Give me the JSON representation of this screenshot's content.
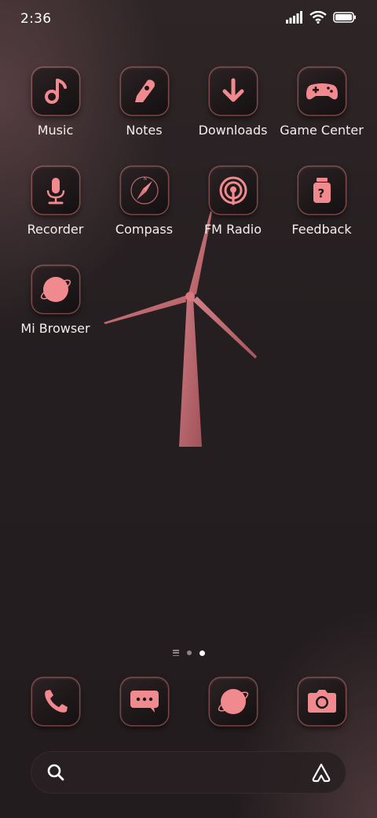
{
  "status_bar": {
    "time": "2:36",
    "icons": [
      "signal-icon",
      "wifi-icon",
      "battery-icon"
    ]
  },
  "apps": [
    {
      "label": "Music",
      "icon": "music-note-icon"
    },
    {
      "label": "Notes",
      "icon": "notes-icon"
    },
    {
      "label": "Downloads",
      "icon": "download-icon"
    },
    {
      "label": "Game Center",
      "icon": "gamepad-icon"
    },
    {
      "label": "Recorder",
      "icon": "microphone-icon"
    },
    {
      "label": "Compass",
      "icon": "compass-icon"
    },
    {
      "label": "FM Radio",
      "icon": "radio-icon"
    },
    {
      "label": "Feedback",
      "icon": "feedback-icon"
    },
    {
      "label": "Mi Browser",
      "icon": "planet-icon"
    }
  ],
  "page_indicator": {
    "pages": 2,
    "current": 2
  },
  "dock": [
    {
      "name": "phone",
      "icon": "phone-icon"
    },
    {
      "name": "messages",
      "icon": "chat-icon"
    },
    {
      "name": "browser",
      "icon": "planet-icon"
    },
    {
      "name": "camera",
      "icon": "camera-icon"
    }
  ],
  "theme": {
    "accent": "#f08a8f",
    "icon_bg": "#1c1617"
  }
}
